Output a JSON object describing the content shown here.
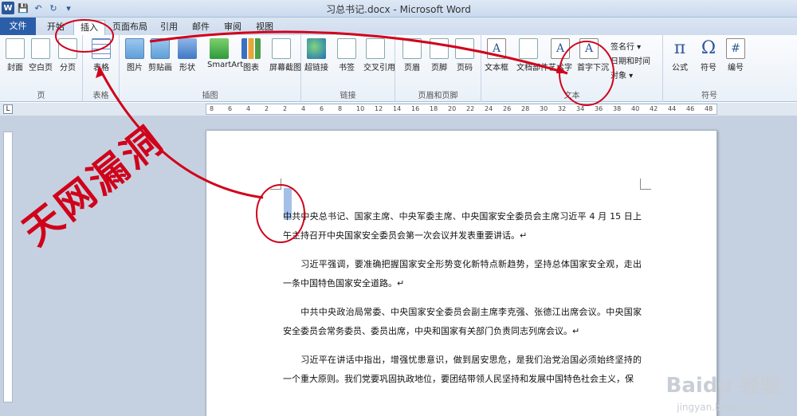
{
  "window": {
    "title": "习总书记.docx - Microsoft Word",
    "app_logo": "W"
  },
  "qat": {
    "save_icon": "💾",
    "undo_icon": "↶",
    "redo_icon": "↻",
    "menu_icon": "▾"
  },
  "tabs": [
    "文件",
    "开始",
    "插入",
    "页面布局",
    "引用",
    "邮件",
    "审阅",
    "视图"
  ],
  "active_tab": "插入",
  "ribbon": {
    "groups": {
      "page": {
        "label": "页",
        "buttons": [
          "封面",
          "空白页",
          "分页"
        ]
      },
      "table": {
        "label": "表格",
        "buttons": [
          "表格"
        ]
      },
      "illustrations": {
        "label": "插图",
        "buttons": [
          "图片",
          "剪贴画",
          "形状",
          "SmartArt",
          "图表",
          "屏幕截图"
        ]
      },
      "links": {
        "label": "链接",
        "buttons": [
          "超链接",
          "书签",
          "交叉引用"
        ]
      },
      "header_footer": {
        "label": "页眉和页脚",
        "buttons": [
          "页眉",
          "页脚",
          "页码"
        ]
      },
      "text": {
        "label": "文本",
        "buttons": [
          "文本框",
          "文档部件",
          "艺术字",
          "首字下沉"
        ],
        "small": [
          "签名行 ▾",
          "日期和时间",
          "对象 ▾"
        ]
      },
      "symbols": {
        "label": "符号",
        "buttons": [
          "公式",
          "符号",
          "编号"
        ]
      }
    }
  },
  "ruler_ticks": [
    "8",
    "6",
    "4",
    "2",
    "2",
    "4",
    "6",
    "8",
    "10",
    "12",
    "14",
    "16",
    "18",
    "20",
    "22",
    "24",
    "26",
    "28",
    "30",
    "32",
    "34",
    "36",
    "38",
    "40",
    "42",
    "44",
    "46",
    "48"
  ],
  "document": {
    "paragraphs": [
      "中共中央总书记、国家主席、中央军委主席、中央国家安全委员会主席习近平 4 月 15 日上午主持召开中央国家安全委员会第一次会议并发表重要讲话。↵",
      "习近平强调，要准确把握国家安全形势变化新特点新趋势，坚持总体国家安全观，走出一条中国特色国家安全道路。↵",
      "中共中央政治局常委、中央国家安全委员会副主席李克强、张德江出席会议。中央国家安全委员会常务委员、委员出席，中央和国家有关部门负责同志列席会议。↵",
      "习近平在讲话中指出，增强忧患意识，做到居安思危，是我们治党治国必须始终坚持的一个重大原则。我们党要巩固执政地位，要团结带领人民坚持和发展中国特色社会主义，保"
    ]
  },
  "annotation": {
    "brush_text": "天网漏洞",
    "color": "#d0021b"
  },
  "watermark": {
    "main": "Baidu 经验",
    "sub": "jingyan.baidu.com"
  }
}
